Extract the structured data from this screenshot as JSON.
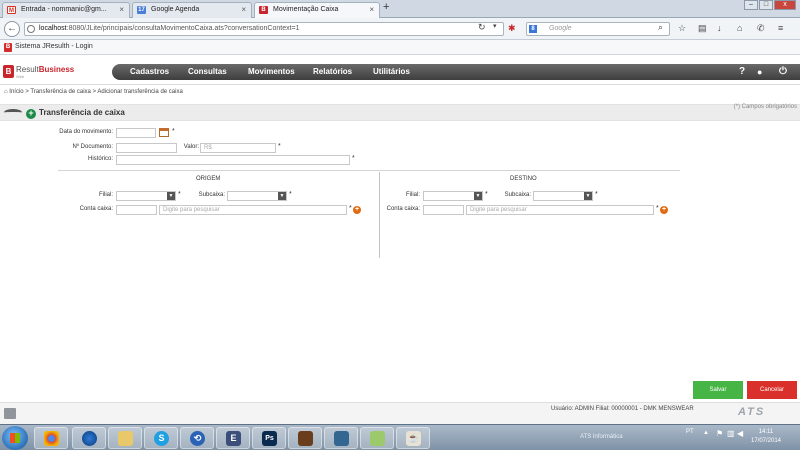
{
  "browser": {
    "tabs": [
      {
        "label": "Entrada - nommanic@gm...",
        "icon": "gmail-icon",
        "active": false
      },
      {
        "label": "Google Agenda",
        "icon": "calendar-icon",
        "active": false
      },
      {
        "label": "Movimentação Caixa",
        "icon": "jresulth-icon",
        "active": true
      }
    ],
    "url_host": "localhost",
    "url_rest": ":8080/JLite/principais/consultaMovimentoCaixa.ats?conversationContext=1",
    "search_placeholder": "Google",
    "bookmark": "Sistema JResulth - Login"
  },
  "app": {
    "logo_part1": "Result",
    "logo_part2": "Business",
    "logo_sub": "Web",
    "menu": [
      "Cadastros",
      "Consultas",
      "Movimentos",
      "Relatórios",
      "Utilitários"
    ],
    "help_icon": "?",
    "user_icon": "user-icon",
    "power_icon": "power-icon"
  },
  "breadcrumb": {
    "home": "Início",
    "level1": "Transferência de caixa",
    "level2": "Adicionar transferência de caixa",
    "sep": ">"
  },
  "section": {
    "title": "Transferência de caixa",
    "required_note": "(*) Campos obrigatórios"
  },
  "form": {
    "data_movimento_label": "Data do movimento:",
    "data_movimento_value": "",
    "documento_label": "Nº Documento:",
    "documento_value": "",
    "valor_label": "Valor:",
    "valor_placeholder": "R$",
    "historico_label": "Histórico:",
    "historico_value": "",
    "required_mark": "*"
  },
  "origem": {
    "title": "ORIGEM",
    "filial_label": "Filial:",
    "subcaixa_label": "Subcaixa:",
    "conta_label": "Conta caixa:",
    "conta_placeholder": "Digite para pesquisar"
  },
  "destino": {
    "title": "DESTINO",
    "filial_label": "Filial:",
    "subcaixa_label": "Subcaixa:",
    "conta_label": "Conta caixa:",
    "conta_placeholder": "Digite para pesquisar"
  },
  "buttons": {
    "save": "Salvar",
    "cancel": "Cancelar"
  },
  "footer": {
    "status": "Usuário: ADMIN   Filial: 00000001 - DMK MENSWEAR",
    "logo": "ATS"
  },
  "taskbar": {
    "language": "PT",
    "tray_label": "ATS Informática",
    "time": "14:11",
    "date": "17/07/2014"
  }
}
